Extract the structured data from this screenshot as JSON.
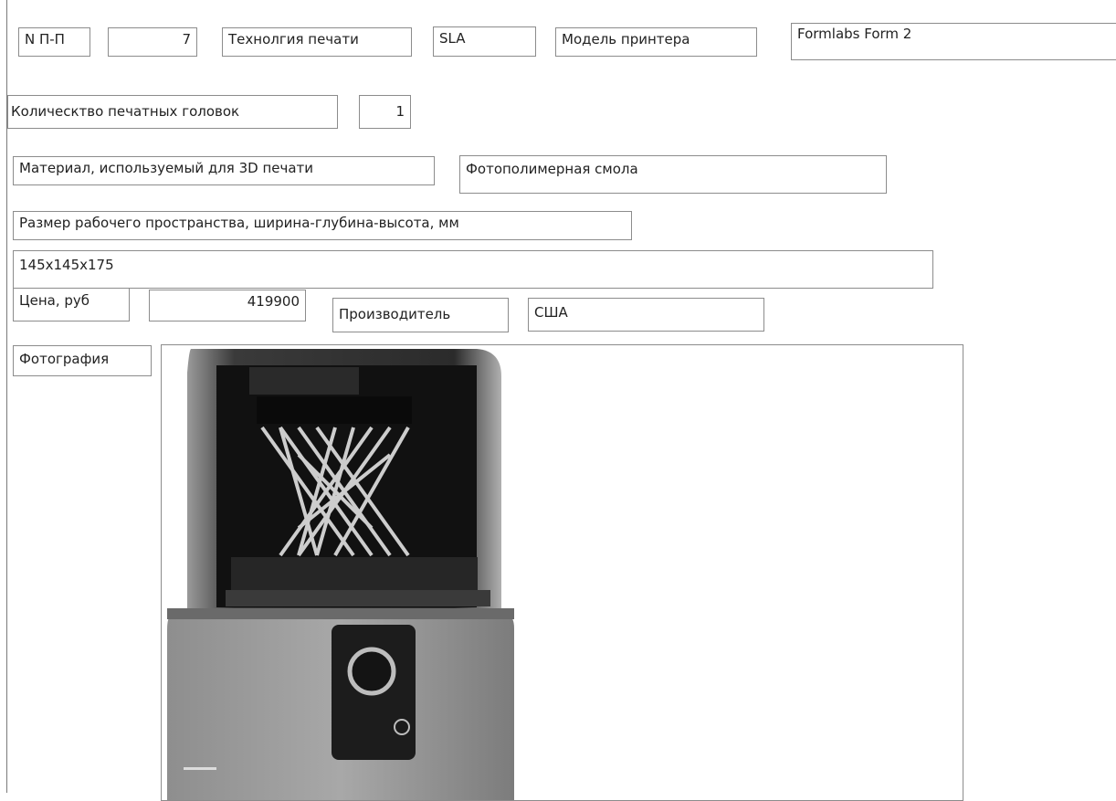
{
  "fields": {
    "np_label": "N П-П",
    "np_value": "7",
    "tech_label": "Технолгия печати",
    "tech_value": "SLA",
    "model_label": "Модель принтера",
    "model_value": "Formlabs Form 2",
    "heads_label": "Колическтво печатных головок",
    "heads_value": "1",
    "material_label": "Материал, используемый для 3D печати",
    "material_value": "Фотополимерная смола",
    "size_label": "Размер рабочего пространства, ширина-глубина-высота, мм",
    "size_value": "145x145x175",
    "price_label": "Цена, руб",
    "price_value": "419900",
    "maker_label": "Производитель",
    "maker_value": "США",
    "photo_label": "Фотография"
  },
  "photo": {
    "subject": "Formlabs Form 2 printer",
    "icon": "printer-photo"
  }
}
